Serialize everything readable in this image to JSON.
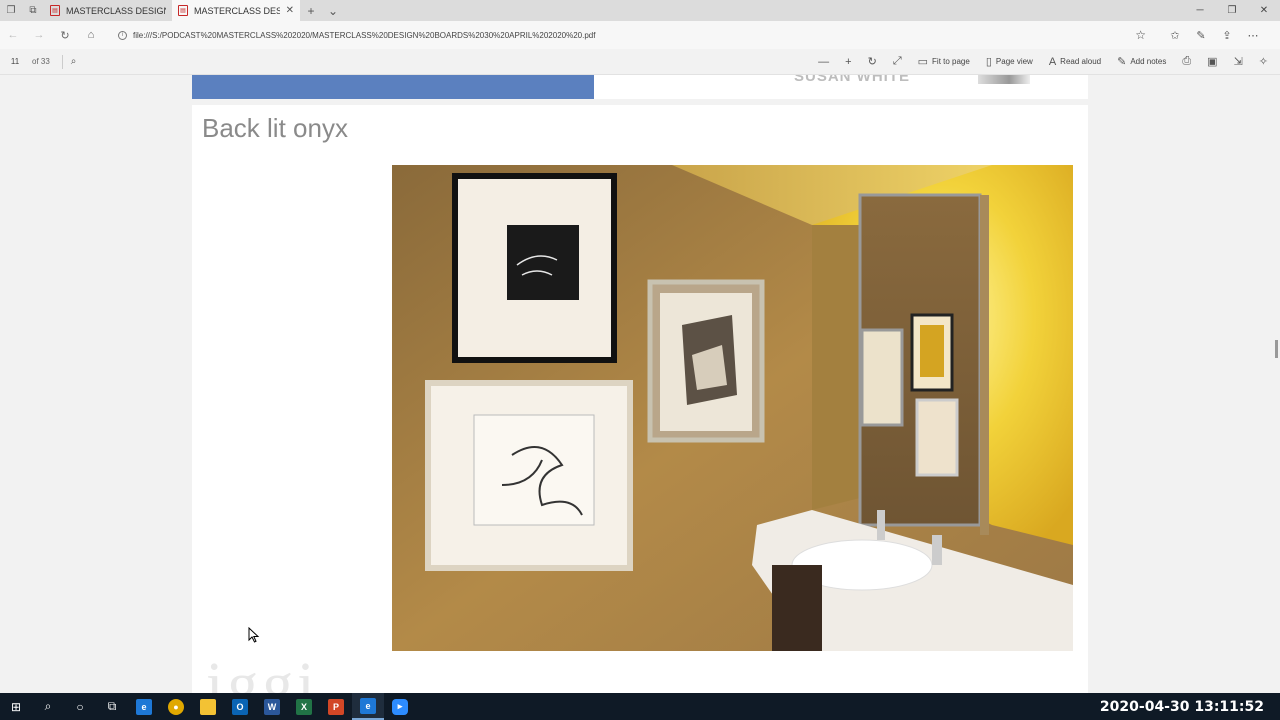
{
  "browser": {
    "tabs": [
      {
        "title": "MASTERCLASS DESIGN BOA",
        "active": false
      },
      {
        "title": "MASTERCLASS DESIGN",
        "active": true
      }
    ],
    "url": "file:///S:/PODCAST%20MASTERCLASS%202020/MASTERCLASS%20DESIGN%20BOARDS%2030%20APRIL%202020%20.pdf"
  },
  "pdf_toolbar": {
    "page_number": "11",
    "page_count": "of 33",
    "fit_to_page": "Fit to page",
    "page_view": "Page view",
    "read_aloud": "Read aloud",
    "add_notes": "Add notes"
  },
  "document": {
    "prev_page_name": "SUSAN WHITE",
    "slide_title": "Back lit onyx",
    "logo_text": "iggi"
  },
  "taskbar": {
    "clock": "2020-04-30  13:11:52"
  },
  "colors": {
    "accent_blue": "#5b80bf",
    "onyx_glow": "#f2d23a"
  }
}
